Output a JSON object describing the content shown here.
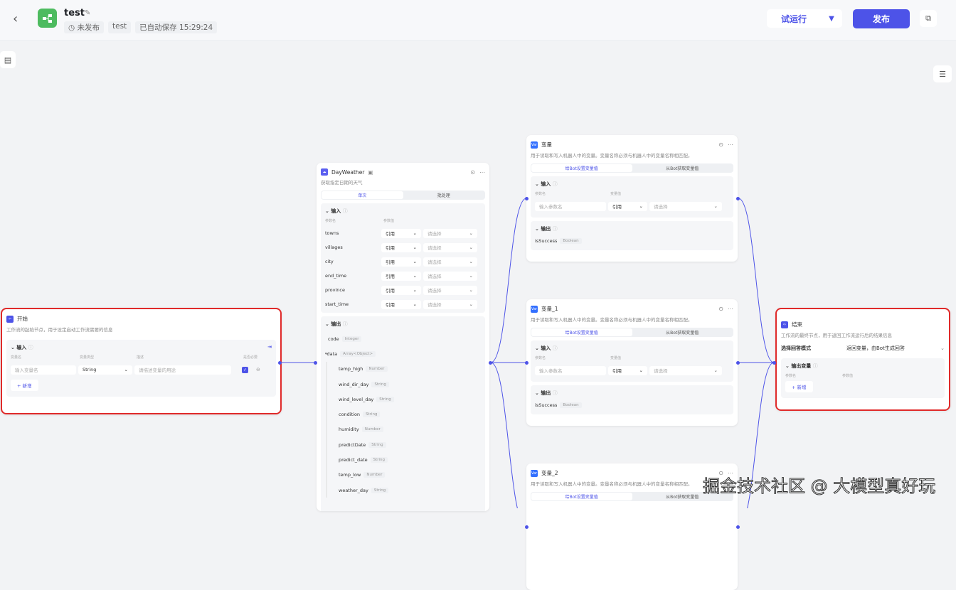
{
  "header": {
    "title": "test",
    "status": "未发布",
    "tag": "test",
    "autosave": "已自动保存 15:29:24",
    "run_label": "试运行",
    "publish_label": "发布"
  },
  "colors": {
    "accent": "#4d53e8",
    "selected_border": "#e02a2a",
    "logo": "#4dbb5f"
  },
  "start": {
    "title": "开始",
    "desc": "工作流的起始节点，用于设定启动工作流需要的信息",
    "input_label": "输入",
    "cols": [
      "变量名",
      "变量类型",
      "描述",
      "是否必要"
    ],
    "name_placeholder": "输入变量名",
    "type": "String",
    "desc_placeholder": "请描述变量的用途",
    "required": true,
    "add_label": "新增"
  },
  "dayweather": {
    "title": "DayWeather",
    "desc": "获取指定日期的天气",
    "tabs": [
      "单次",
      "批处理"
    ],
    "input_label": "输入",
    "cols": [
      "参数名",
      "参数值"
    ],
    "inputs": [
      {
        "name": "towns",
        "mode": "引用",
        "value": "请选择"
      },
      {
        "name": "villages",
        "mode": "引用",
        "value": "请选择"
      },
      {
        "name": "city",
        "mode": "引用",
        "value": "请选择"
      },
      {
        "name": "end_time",
        "mode": "引用",
        "value": "请选择"
      },
      {
        "name": "province",
        "mode": "引用",
        "value": "请选择"
      },
      {
        "name": "start_time",
        "mode": "引用",
        "value": "请选择"
      }
    ],
    "output_label": "输出",
    "outputs": [
      {
        "name": "code",
        "type": "Integer"
      },
      {
        "name": "data",
        "type": "Array<Object>"
      }
    ],
    "data_children": [
      {
        "name": "temp_high",
        "type": "Number"
      },
      {
        "name": "wind_dir_day",
        "type": "String"
      },
      {
        "name": "wind_level_day",
        "type": "String"
      },
      {
        "name": "condition",
        "type": "String"
      },
      {
        "name": "humidity",
        "type": "Number"
      },
      {
        "name": "predictDate",
        "type": "String"
      },
      {
        "name": "predict_date",
        "type": "String"
      },
      {
        "name": "temp_low",
        "type": "Number"
      },
      {
        "name": "weather_day",
        "type": "String"
      }
    ]
  },
  "variables": [
    {
      "title": "变量",
      "desc": "用于读取和写入机器人中的变量。变量名称必须与机器人中的变量名称相匹配。",
      "tabs": [
        "给Bot设置变量值",
        "从Bot获取变量值"
      ],
      "input_label": "输入",
      "cols": [
        "参数名",
        "变量值"
      ],
      "name_placeholder": "输入参数名",
      "mode": "引用",
      "value": "请选择",
      "output_label": "输出",
      "out_name": "isSuccess",
      "out_type": "Boolean"
    },
    {
      "title": "变量_1",
      "desc": "用于读取和写入机器人中的变量。变量名称必须与机器人中的变量名称相匹配。",
      "tabs": [
        "给Bot设置变量值",
        "从Bot获取变量值"
      ],
      "input_label": "输入",
      "cols": [
        "参数名",
        "变量值"
      ],
      "name_placeholder": "输入参数名",
      "mode": "引用",
      "value": "请选择",
      "output_label": "输出",
      "out_name": "isSuccess",
      "out_type": "Boolean"
    },
    {
      "title": "变量_2",
      "desc": "用于读取和写入机器人中的变量。变量名称必须与机器人中的变量名称相匹配。",
      "tabs": [
        "给Bot设置变量值",
        "从Bot获取变量值"
      ]
    }
  ],
  "end": {
    "title": "结束",
    "desc": "工作流的最终节点，用于返回工作流运行后的结果信息",
    "mode_label": "选择回答模式",
    "mode_value": "返回变量，由Bot生成回答",
    "output_label": "输出变量",
    "cols": [
      "参数名",
      "参数值"
    ],
    "add_label": "新增"
  },
  "watermark": "掘金技术社区 @ 大模型真好玩"
}
